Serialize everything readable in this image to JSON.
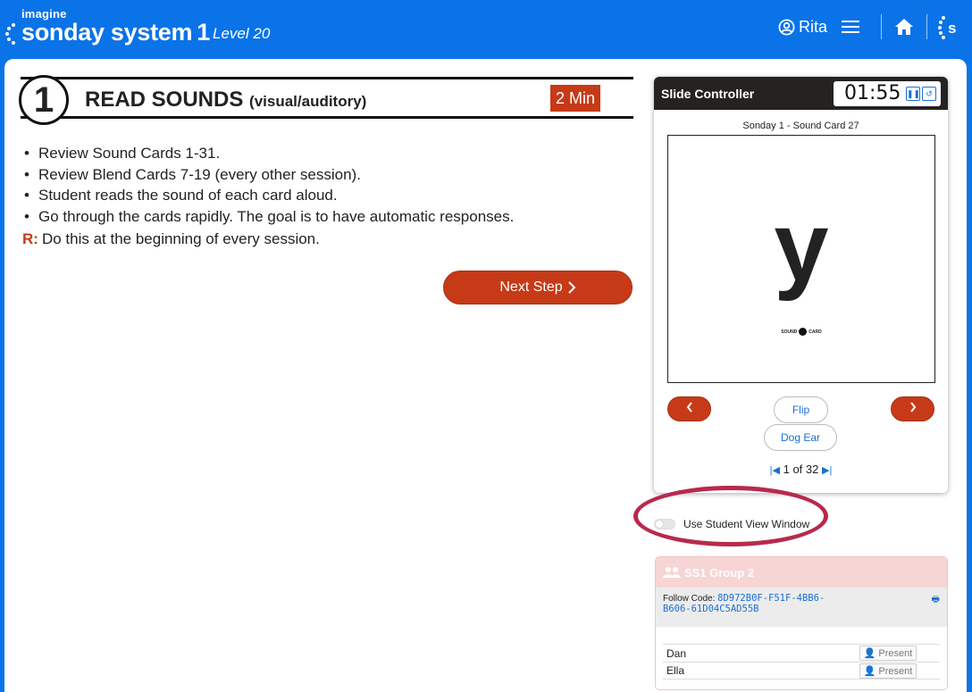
{
  "header": {
    "brand_small": "imagine",
    "brand_main": "sonday system",
    "brand_num": "1",
    "level": "Level 20",
    "user_name": "Rita"
  },
  "step": {
    "number": "1",
    "title": "READ SOUNDS",
    "subtitle": "(visual/auditory)",
    "duration": "2 Min",
    "bullets": [
      "Review Sound Cards 1-31.",
      "Review Blend Cards 7-19 (every other session).",
      "Student reads the sound of each card aloud.",
      "Go through the cards rapidly. The goal is to have automatic responses."
    ],
    "remark_label": "R:",
    "remark_text": "Do this at the beginning of every session.",
    "next_label": "Next Step"
  },
  "slide_controller": {
    "title": "Slide Controller",
    "timer": "01:55",
    "slide_caption": "Sonday 1 - Sound Card 27",
    "card_letter": "y",
    "card_tag_left": "SOUND",
    "card_tag_right": "CARD",
    "prev_icon": "chevron-left",
    "next_icon": "chevron-right",
    "flip_label": "Flip",
    "dog_ear_label": "Dog Ear",
    "pager_text": "1 of 32"
  },
  "student_view": {
    "label": "Use Student View Window",
    "enabled": false
  },
  "group": {
    "name": "SS1 Group 2",
    "follow_label": "Follow Code:",
    "follow_code_line1": "8D972B0F-F51F-4BB6-",
    "follow_code_line2": "B606-61D04C5AD55B",
    "students": [
      {
        "name": "Dan",
        "status": "Present"
      },
      {
        "name": "Ella",
        "status": "Present"
      }
    ]
  },
  "colors": {
    "brand_blue": "#0a73e8",
    "accent_red": "#c63a17",
    "highlight_ring": "#b82a4d"
  }
}
